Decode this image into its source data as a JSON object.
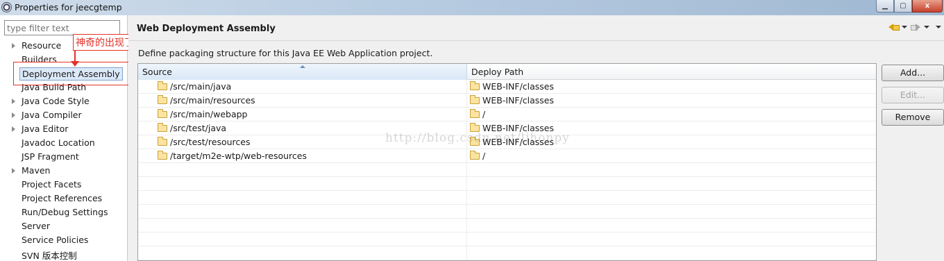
{
  "window": {
    "title": "Properties for jeecgtemp",
    "close_glyph": "x"
  },
  "filter": {
    "placeholder": "type filter text"
  },
  "tree": {
    "items": [
      {
        "label": "Resource",
        "has_children": true
      },
      {
        "label": "Builders",
        "has_children": false
      },
      {
        "label": "Deployment Assembly",
        "has_children": false,
        "selected": true
      },
      {
        "label": "Java Build Path",
        "has_children": false
      },
      {
        "label": "Java Code Style",
        "has_children": true
      },
      {
        "label": "Java Compiler",
        "has_children": true
      },
      {
        "label": "Java Editor",
        "has_children": true
      },
      {
        "label": "Javadoc Location",
        "has_children": false
      },
      {
        "label": "JSP Fragment",
        "has_children": false
      },
      {
        "label": "Maven",
        "has_children": true
      },
      {
        "label": "Project Facets",
        "has_children": false
      },
      {
        "label": "Project References",
        "has_children": false
      },
      {
        "label": "Run/Debug Settings",
        "has_children": false
      },
      {
        "label": "Server",
        "has_children": false
      },
      {
        "label": "Service Policies",
        "has_children": false
      },
      {
        "label": "SVN 版本控制",
        "has_children": false
      }
    ]
  },
  "annotation": {
    "text": "神奇的出现了",
    "color": "#e3312a"
  },
  "page": {
    "title": "Web Deployment Assembly",
    "description": "Define packaging structure for this Java EE Web Application project."
  },
  "table": {
    "columns": [
      "Source",
      "Deploy Path"
    ],
    "rows": [
      {
        "source": "/src/main/java",
        "deploy": "WEB-INF/classes"
      },
      {
        "source": "/src/main/resources",
        "deploy": "WEB-INF/classes"
      },
      {
        "source": "/src/main/webapp",
        "deploy": "/"
      },
      {
        "source": "/src/test/java",
        "deploy": "WEB-INF/classes"
      },
      {
        "source": "/src/test/resources",
        "deploy": "WEB-INF/classes"
      },
      {
        "source": "/target/m2e-wtp/web-resources",
        "deploy": "/"
      }
    ]
  },
  "buttons": {
    "add": "Add...",
    "edit": "Edit...",
    "remove": "Remove"
  },
  "watermark": "http://blog.csdn.net/ljhonpy"
}
